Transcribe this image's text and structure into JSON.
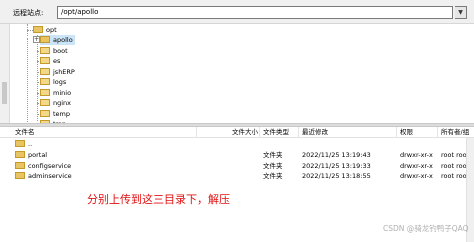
{
  "address_bar": {
    "label": "远程站点:",
    "path": "/opt/apollo"
  },
  "tree": {
    "root": "opt",
    "items": [
      {
        "label": "apollo",
        "highlighted": true,
        "expandable": true
      },
      {
        "label": "boot",
        "highlighted": false,
        "expandable": false
      },
      {
        "label": "es",
        "highlighted": false,
        "expandable": false
      },
      {
        "label": "jshERP",
        "highlighted": false,
        "expandable": false
      },
      {
        "label": "logs",
        "highlighted": false,
        "expandable": false
      },
      {
        "label": "minio",
        "highlighted": false,
        "expandable": false
      },
      {
        "label": "nginx",
        "highlighted": false,
        "expandable": false
      },
      {
        "label": "temp",
        "highlighted": false,
        "expandable": false
      },
      {
        "label": "tmp",
        "highlighted": false,
        "expandable": false
      }
    ]
  },
  "file_list": {
    "columns": [
      "文件名",
      "文件大小",
      "文件类型",
      "最近修改",
      "权限",
      "所有者/组"
    ],
    "rows": [
      {
        "name": "..",
        "size": "",
        "type": "",
        "modified": "",
        "perms": "",
        "owner": ""
      },
      {
        "name": "portal",
        "size": "",
        "type": "文件夹",
        "modified": "2022/11/25 13:19:43",
        "perms": "drwxr-xr-x",
        "owner": "root root"
      },
      {
        "name": "configservice",
        "size": "",
        "type": "文件夹",
        "modified": "2022/11/25 13:19:33",
        "perms": "drwxr-xr-x",
        "owner": "root root"
      },
      {
        "name": "adminservice",
        "size": "",
        "type": "文件夹",
        "modified": "2022/11/25 13:18:55",
        "perms": "drwxr-xr-x",
        "owner": "root root"
      }
    ]
  },
  "annotation": "分别上传到这三目录下，解压",
  "watermark": "CSDN @骑龙钓鸭子QAQ",
  "colors": {
    "annotation": "#e11010",
    "folder": "#e8c463",
    "highlight": "#cce4f7"
  }
}
